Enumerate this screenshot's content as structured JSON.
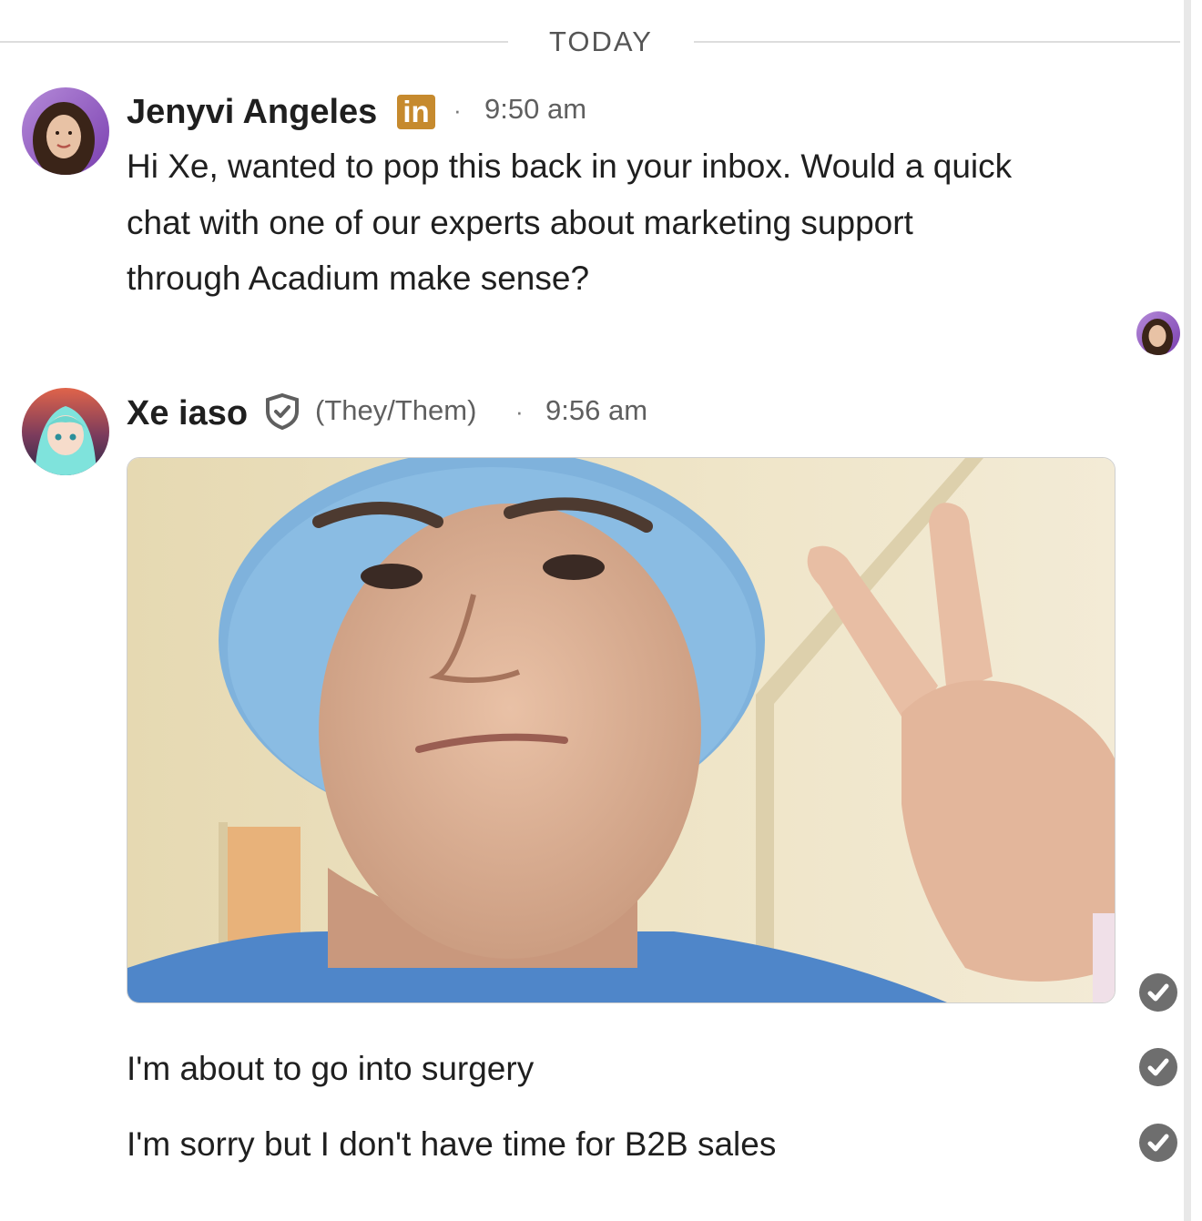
{
  "divider": {
    "label": "TODAY"
  },
  "messages": [
    {
      "sender": "Jenyvi Angeles",
      "badge": "in",
      "time": "9:50 am",
      "lines": [
        "Hi Xe, wanted to pop this back in your inbox. Would a quick",
        "chat with one of our experts about marketing support",
        "through Acadium make sense?"
      ]
    },
    {
      "sender": "Xe iaso",
      "pronouns": "(They/Them)",
      "time": "9:56 am",
      "texts": [
        "I'm about to go into surgery",
        "I'm sorry but I don't have time for B2B sales"
      ]
    }
  ],
  "meta_separator": "·",
  "colors": {
    "linkedin_badge": "#c68a2e",
    "read_receipt": "#6e6e6e",
    "divider": "#dddddd"
  },
  "icons": [
    "linkedin-icon",
    "verified-shield-icon",
    "checkmark-icon"
  ]
}
